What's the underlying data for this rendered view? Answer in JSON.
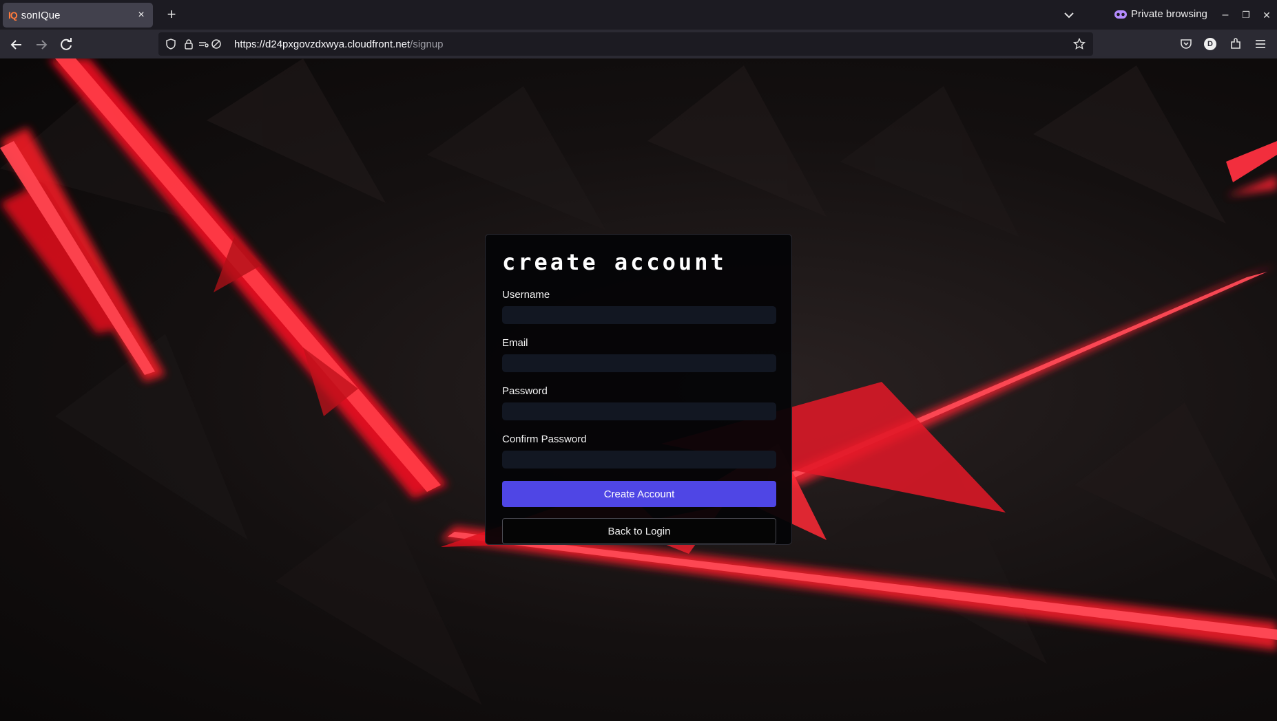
{
  "browser": {
    "tab": {
      "favicon_text": "IQ",
      "title": "sonIQue",
      "close": "×"
    },
    "new_tab": "+",
    "private_label": "Private browsing",
    "window_controls": {
      "minimize": "–",
      "restore": "❐",
      "close": "✕"
    },
    "url": {
      "host": "https://d24pxgovzdxwya.cloudfront.net",
      "path": "/signup"
    },
    "profile_initial": "D",
    "icons": [
      "back-icon",
      "forward-icon",
      "reload-icon",
      "shield-icon",
      "lock-icon",
      "permissions-icon",
      "tracking-icon",
      "bookmark-star-icon",
      "pocket-icon",
      "extensions-icon",
      "menu-icon"
    ]
  },
  "form": {
    "title": "create account",
    "fields": [
      {
        "label": "Username",
        "value": "",
        "type": "text"
      },
      {
        "label": "Email",
        "value": "",
        "type": "email"
      },
      {
        "label": "Password",
        "value": "",
        "type": "password"
      },
      {
        "label": "Confirm Password",
        "value": "",
        "type": "password"
      }
    ],
    "submit_label": "Create Account",
    "back_label": "Back to Login"
  },
  "colors": {
    "accent": "#4f46e5",
    "background_laser": "#ff1f2e",
    "card": "#040406"
  }
}
